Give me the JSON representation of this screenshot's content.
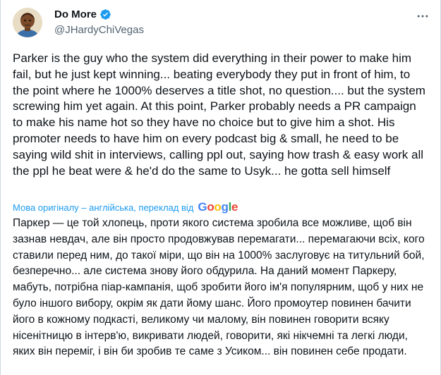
{
  "author": {
    "display_name": "Do More",
    "handle": "@JHardyChiVegas"
  },
  "icons": {
    "avatar": "cartoon-avatar-icon",
    "verified": "verified-badge-icon",
    "more": "more-options-icon"
  },
  "colors": {
    "accent": "#1d9bf0",
    "text": "#0f1419",
    "secondary": "#536471"
  },
  "tweet": {
    "text": "Parker is the guy who the system did everything in their power to make him fail, but he just kept winning... beating everybody they put in front of him, to the point where he 1000% deserves a title shot, no question.... but the system screwing him yet again. At this point, Parker probably needs a PR campaign to make his name hot so they have no choice but to give him a shot. His promoter needs to have him on every podcast big & small, he need to be saying wild shit in interviews, calling ppl out, saying how trash & easy work all the ppl he beat were & he'd do the same to Usyk... he gotta sell himself"
  },
  "translation": {
    "label": "Мова оригіналу – англійська, переклад від",
    "provider": "Google",
    "text": "Паркер — це той хлопець, проти якого система зробила все можливе, щоб він зазнав невдач, але він просто продовжував перемагати... перемагаючи всіх, кого ставили перед ним, до такої міри, що він на 1000% заслуговує на титульний бой, безперечно... але система знову його обдурила. На даний момент Паркеру, мабуть, потрібна піар-кампанія, щоб зробити його ім'я популярним, щоб у них не було іншого вибору, окрім як дати йому шанс. Його промоутер повинен бачити його в кожному подкасті, великому чи малому, він повинен говорити всяку нісенітницю в інтерв'ю, викривати людей, говорити, які нікчемні та легкі люди, яких він переміг, і він би зробив те саме з Усиком... він повинен себе продати."
  }
}
